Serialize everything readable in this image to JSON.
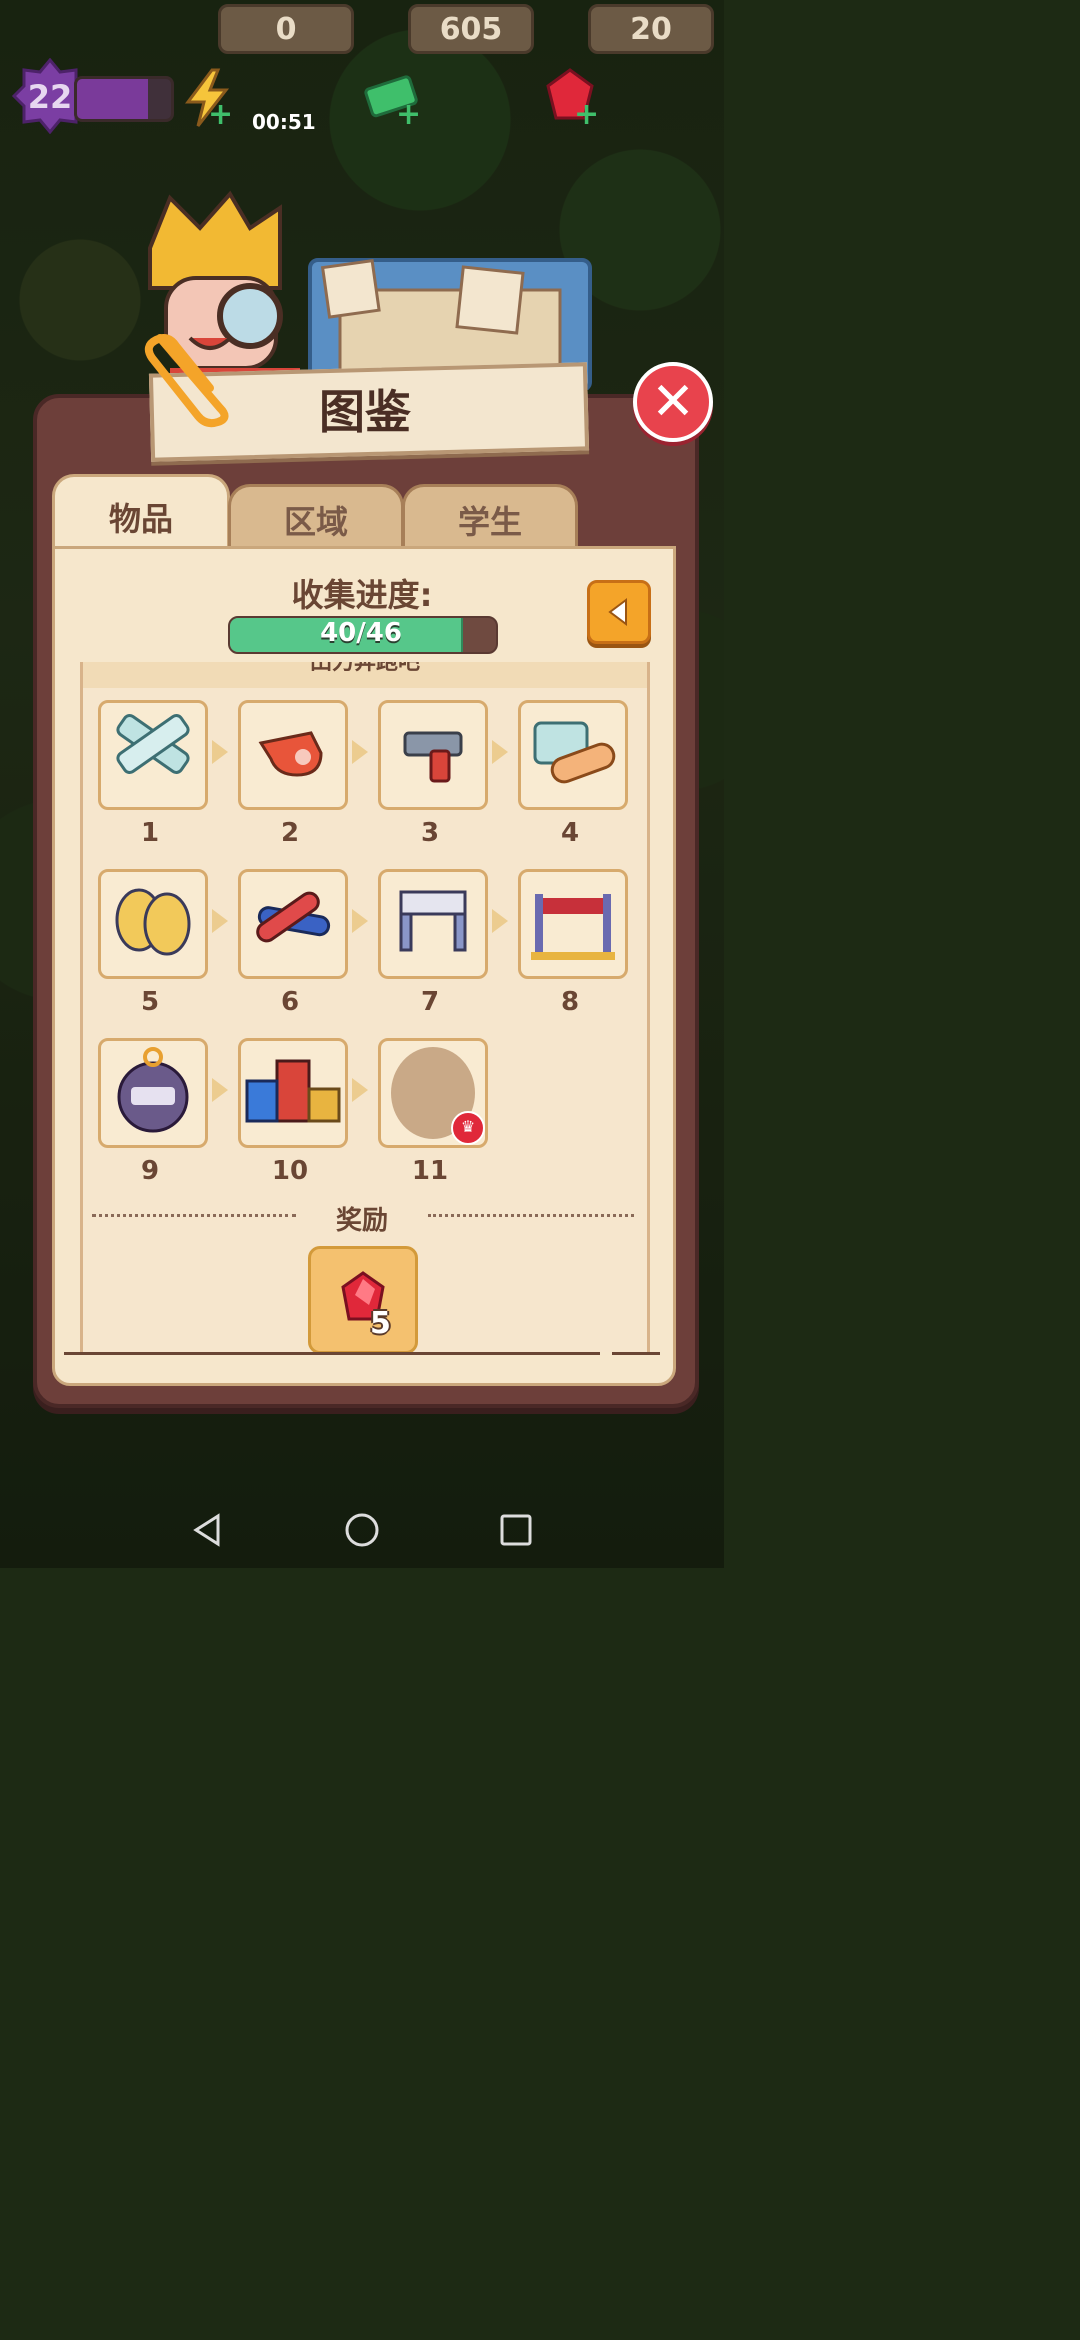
{
  "hud": {
    "level": "22",
    "level_progress": 0.75,
    "energy": "0",
    "energy_timer": "00:51",
    "cash": "605",
    "gems": "20"
  },
  "panel": {
    "title": "图鉴",
    "tabs": [
      {
        "label": "物品",
        "active": true
      },
      {
        "label": "区域",
        "active": false
      },
      {
        "label": "学生",
        "active": false
      }
    ],
    "progress_label": "收集进度:",
    "progress_text": "40/46",
    "progress_value": 0.87,
    "section_title": "田力奔跑吧",
    "items": [
      {
        "num": "1",
        "icon": "bandage-strips-icon"
      },
      {
        "num": "2",
        "icon": "whistle-icon"
      },
      {
        "num": "3",
        "icon": "starting-pistol-icon"
      },
      {
        "num": "4",
        "icon": "band-aid-icon"
      },
      {
        "num": "5",
        "icon": "sneakers-icon"
      },
      {
        "num": "6",
        "icon": "relay-baton-icon"
      },
      {
        "num": "7",
        "icon": "hurdle-icon"
      },
      {
        "num": "8",
        "icon": "finish-line-icon"
      },
      {
        "num": "9",
        "icon": "stopwatch-icon"
      },
      {
        "num": "10",
        "icon": "podium-icon"
      },
      {
        "num": "11",
        "icon": "locked-item-icon"
      }
    ],
    "reward_label": "奖励",
    "reward_count": "5"
  },
  "colors": {
    "panel_bg": "#6d3f3a",
    "inner_bg": "#f6e7cc",
    "progress_fill": "#56c78a",
    "close_red": "#e8434d",
    "back_orange": "#f4a429"
  }
}
